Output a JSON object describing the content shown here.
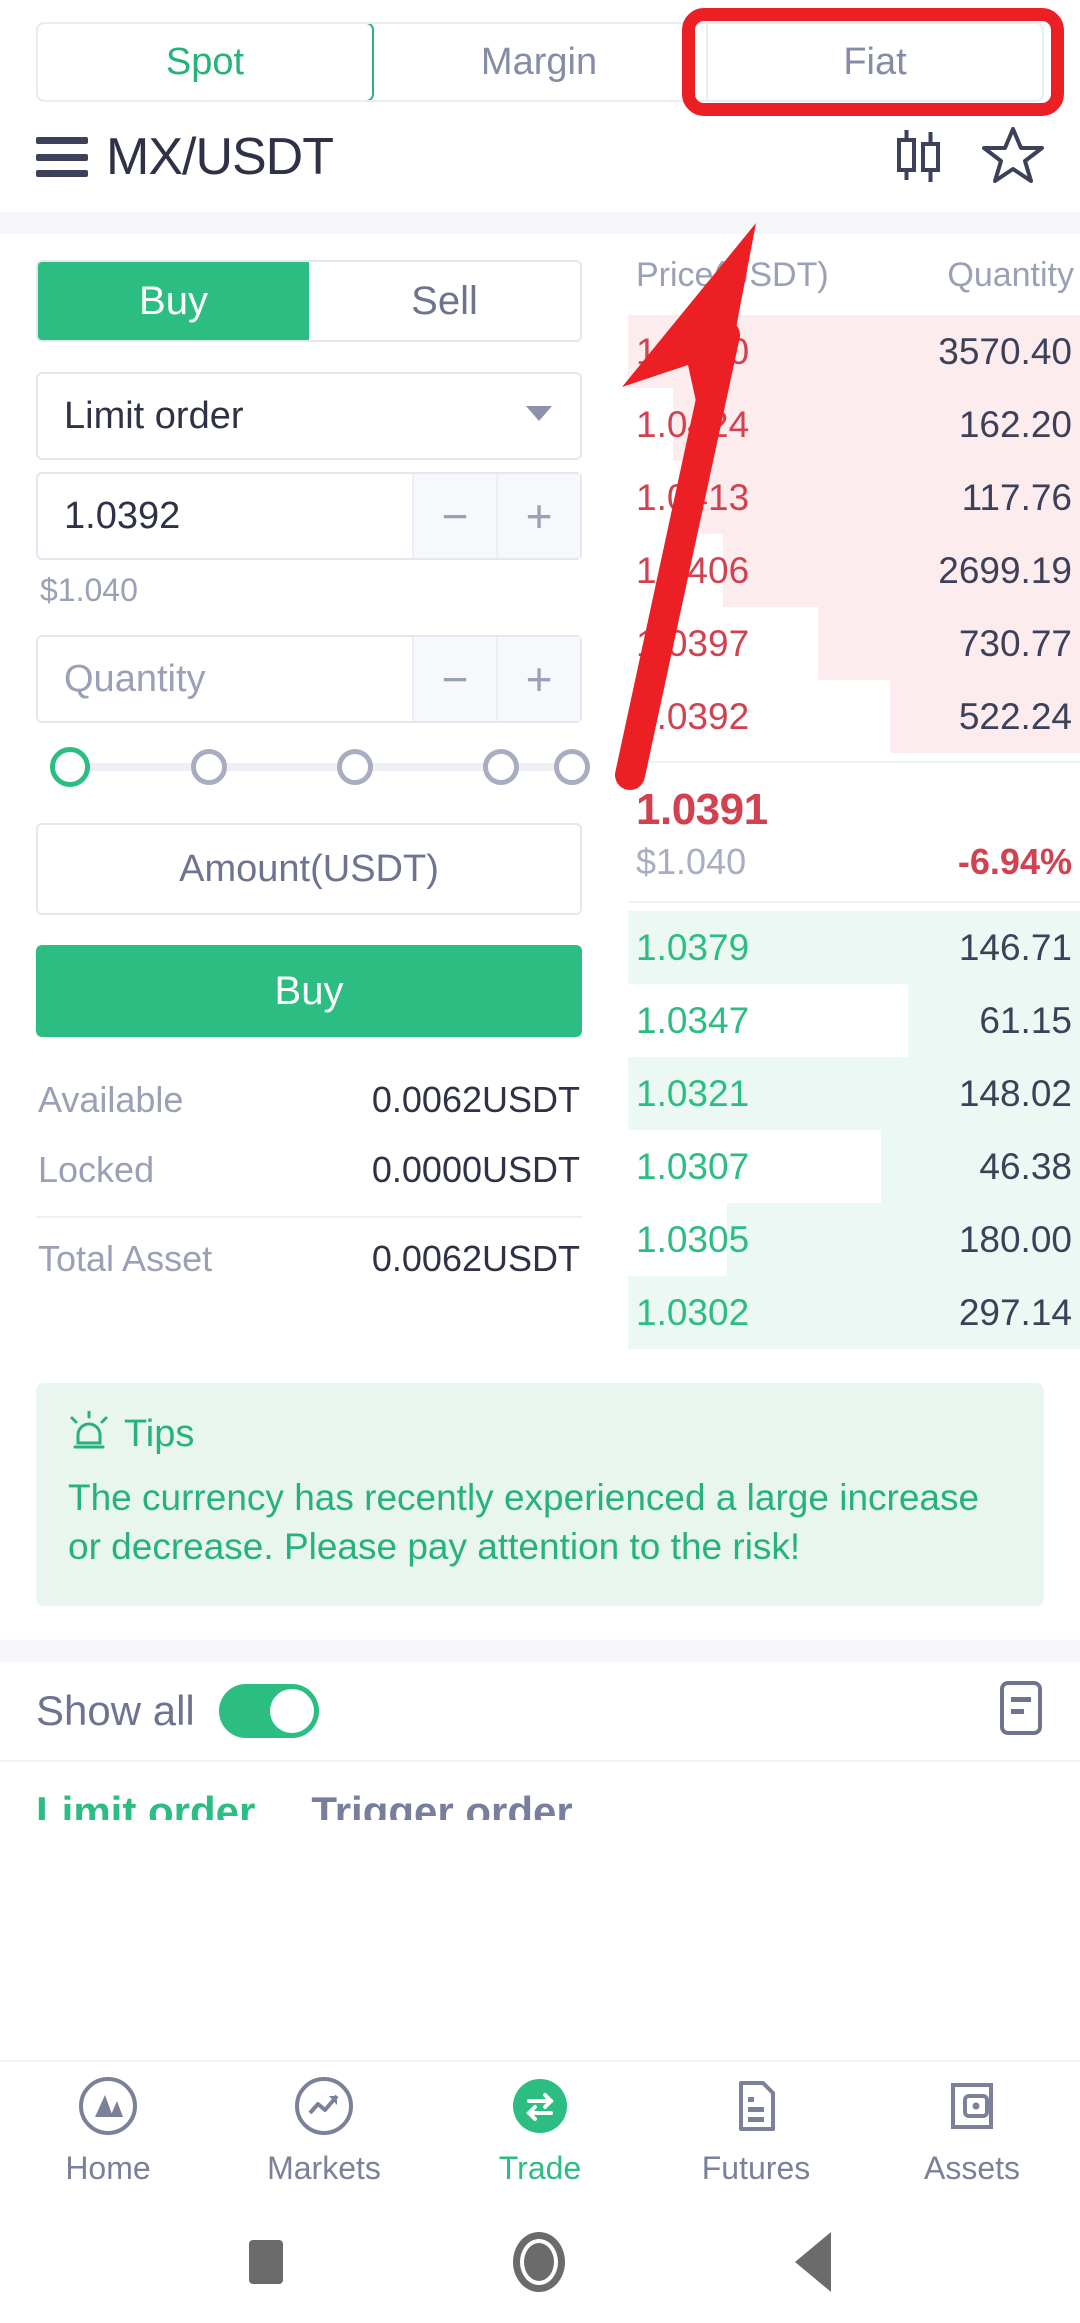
{
  "market_tabs": [
    {
      "label": "Spot",
      "active": true
    },
    {
      "label": "Margin",
      "active": false
    },
    {
      "label": "Fiat",
      "active": false,
      "highlighted": true
    }
  ],
  "header": {
    "pair": "MX/USDT",
    "menu_icon": "hamburger-icon",
    "chart_icon": "candlestick-chart-icon",
    "favorite_icon": "star-outline-icon"
  },
  "order_form": {
    "side_tabs": [
      {
        "label": "Buy",
        "active": true
      },
      {
        "label": "Sell",
        "active": false
      }
    ],
    "order_type": "Limit order",
    "price_value": "1.0392",
    "price_fiat": "$1.040",
    "quantity_placeholder": "Quantity",
    "minus_label": "−",
    "plus_label": "+",
    "percent_steps": [
      "0%",
      "25%",
      "50%",
      "75%",
      "100%"
    ],
    "percent_selected_index": 0,
    "amount_label": "Amount(USDT)",
    "submit_label": "Buy",
    "balances": [
      {
        "label": "Available",
        "value": "0.0062USDT"
      },
      {
        "label": "Locked",
        "value": "0.0000USDT"
      }
    ],
    "total": {
      "label": "Total Asset",
      "value": "0.0062USDT"
    }
  },
  "orderbook": {
    "price_header": "Price(USDT)",
    "quantity_header": "Quantity",
    "asks": [
      {
        "price": "1.0440",
        "quantity": "3570.40",
        "depth_pct": 100
      },
      {
        "price": "1.0424",
        "quantity": "162.20",
        "depth_pct": 90
      },
      {
        "price": "1.0413",
        "quantity": "117.76",
        "depth_pct": 84
      },
      {
        "price": "1.0406",
        "quantity": "2699.19",
        "depth_pct": 79
      },
      {
        "price": "1.0397",
        "quantity": "730.77",
        "depth_pct": 58
      },
      {
        "price": "1.0392",
        "quantity": "522.24",
        "depth_pct": 42
      }
    ],
    "last_price": "1.0391",
    "last_fiat": "$1.040",
    "change_pct": "-6.94%",
    "bids": [
      {
        "price": "1.0379",
        "quantity": "146.71",
        "depth_pct": 100
      },
      {
        "price": "1.0347",
        "quantity": "61.15",
        "depth_pct": 38
      },
      {
        "price": "1.0321",
        "quantity": "148.02",
        "depth_pct": 100
      },
      {
        "price": "1.0307",
        "quantity": "46.38",
        "depth_pct": 44
      },
      {
        "price": "1.0305",
        "quantity": "180.00",
        "depth_pct": 78
      },
      {
        "price": "1.0302",
        "quantity": "297.14",
        "depth_pct": 100
      }
    ]
  },
  "tips": {
    "icon": "alarm-siren-icon",
    "title": "Tips",
    "body": "The currency has recently experienced a large increase or decrease. Please pay attention to the risk!"
  },
  "orders_section": {
    "show_all_label": "Show all",
    "show_all_on": true,
    "list_icon": "order-list-icon",
    "tabs": [
      {
        "label": "Limit order",
        "active": true
      },
      {
        "label": "Trigger order",
        "active": false
      }
    ]
  },
  "bottom_nav": [
    {
      "label": "Home",
      "icon": "home-mountain-icon",
      "active": false
    },
    {
      "label": "Markets",
      "icon": "trend-chart-icon",
      "active": false
    },
    {
      "label": "Trade",
      "icon": "swap-arrows-icon",
      "active": true
    },
    {
      "label": "Futures",
      "icon": "document-icon",
      "active": false
    },
    {
      "label": "Assets",
      "icon": "wallet-icon",
      "active": false
    }
  ],
  "system_nav": [
    {
      "icon": "recents-square-icon"
    },
    {
      "icon": "home-circle-icon"
    },
    {
      "icon": "back-triangle-icon"
    }
  ],
  "annotation": {
    "color": "#ec2024",
    "box_target": "Fiat",
    "arrow_points_to": "Fiat"
  },
  "colors": {
    "green": "#2bbd82",
    "red": "#d1414f",
    "muted": "#9aa0b5",
    "dark": "#3c4058",
    "annotation_red": "#ec2024"
  }
}
